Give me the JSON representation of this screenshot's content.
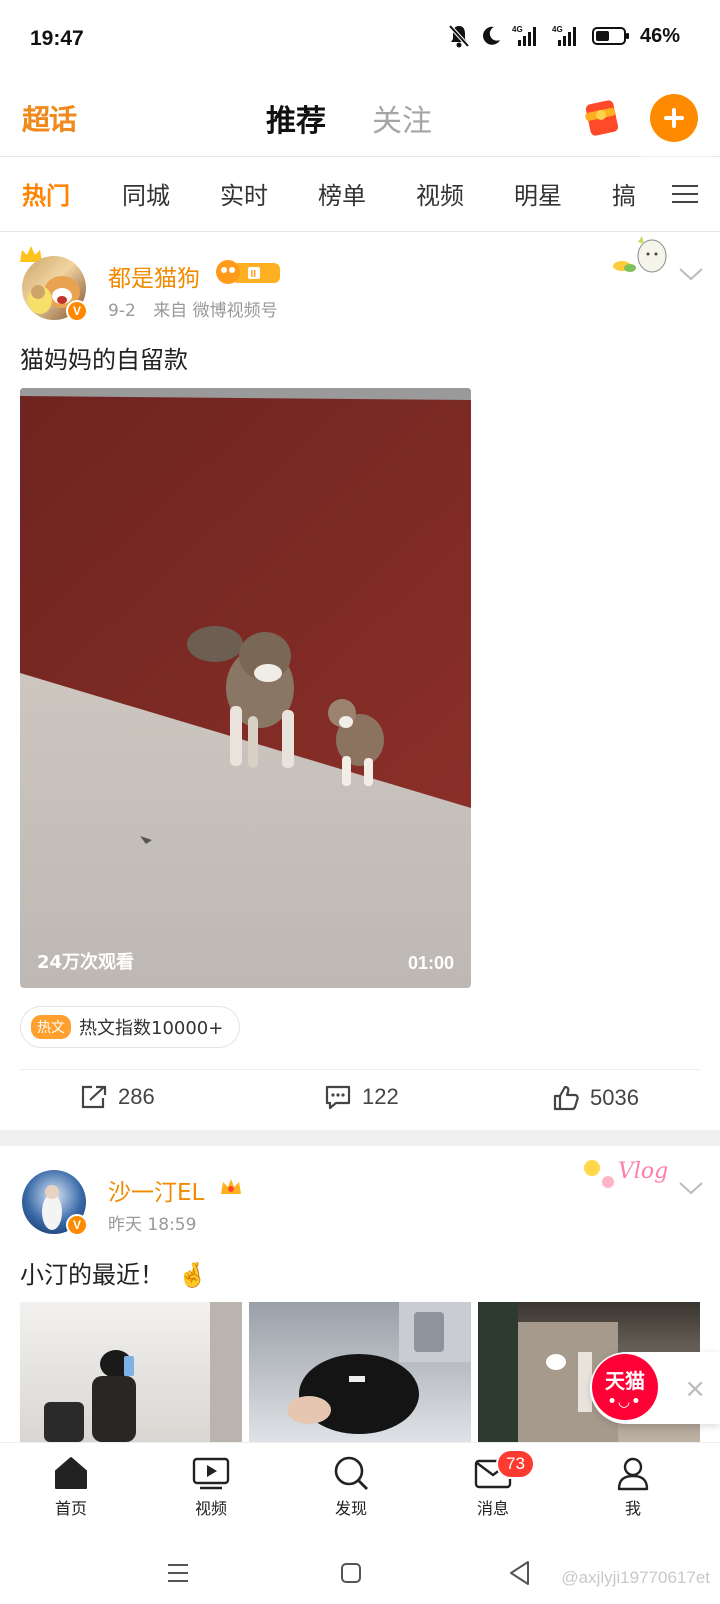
{
  "status_bar": {
    "time": "19:47",
    "battery": "46%",
    "network_1": "4G",
    "network_2": "4G"
  },
  "top_nav": {
    "logo": "超话",
    "tabs": [
      {
        "label": "推荐",
        "active": true
      },
      {
        "label": "关注",
        "active": false
      }
    ]
  },
  "channels": [
    {
      "label": "热门",
      "active": true
    },
    {
      "label": "同城"
    },
    {
      "label": "实时"
    },
    {
      "label": "榜单"
    },
    {
      "label": "视频"
    },
    {
      "label": "明星"
    },
    {
      "label": "搞"
    }
  ],
  "post1": {
    "username": "都是猫狗",
    "date": "9-2",
    "source": "来自 微博视频号",
    "text": "猫妈妈的自留款",
    "video": {
      "views": "24万次观看",
      "duration": "01:00"
    },
    "hot_tag": "热文",
    "hot_text": "热文指数10000+",
    "reposts": "286",
    "comments": "122",
    "likes": "5036"
  },
  "post2": {
    "username": "沙一汀EL",
    "time": "昨天 18:59",
    "text": "小汀的最近！",
    "emoji": "🤞"
  },
  "ad": {
    "brand": "天猫",
    "close": "×"
  },
  "tab_bar": [
    {
      "label": "首页",
      "icon": "home-icon"
    },
    {
      "label": "视频",
      "icon": "video-icon"
    },
    {
      "label": "发现",
      "icon": "search-icon"
    },
    {
      "label": "消息",
      "icon": "mail-icon",
      "badge": "73"
    },
    {
      "label": "我",
      "icon": "profile-icon"
    }
  ],
  "watermark": "@axjlyji19770617et",
  "colors": {
    "accent": "#ff8200",
    "username": "#f08a00",
    "badge_red": "#ff3a30"
  }
}
